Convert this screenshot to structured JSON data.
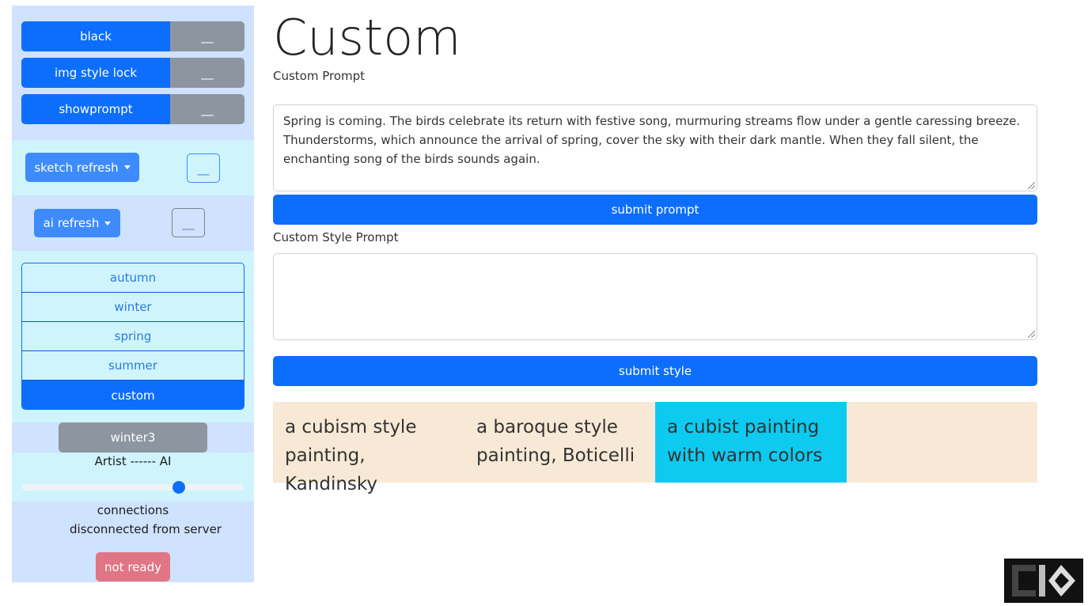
{
  "sidebar": {
    "toggles": [
      {
        "label": "black",
        "toggle_label": "__"
      },
      {
        "label": "img style lock",
        "toggle_label": "__"
      },
      {
        "label": "showprompt",
        "toggle_label": "__"
      }
    ],
    "sketch_refresh": {
      "label": "sketch refresh",
      "toggle_label": "__"
    },
    "ai_refresh": {
      "label": "ai refresh",
      "toggle_label": "__"
    },
    "seasons": [
      {
        "label": "autumn",
        "active": false
      },
      {
        "label": "winter",
        "active": false
      },
      {
        "label": "spring",
        "active": false
      },
      {
        "label": "summer",
        "active": false
      },
      {
        "label": "custom",
        "active": true
      }
    ],
    "preset_button": "winter3",
    "slider": {
      "label": "Artist ------ AI",
      "value_fraction": 0.72
    },
    "connections_label": "connections",
    "connection_status": "disconnected from server",
    "ready_button": "not ready"
  },
  "main": {
    "title": "Custom",
    "custom_prompt_label": "Custom Prompt",
    "custom_prompt_value": "Spring is coming. The birds celebrate its return with festive song, murmuring streams flow under a gentle caressing breeze. Thunderstorms, which announce the arrival of spring, cover the sky with their dark mantle. When they fall silent, the enchanting song of the birds sounds again.",
    "submit_prompt": "submit prompt",
    "custom_style_label": "Custom Style Prompt",
    "custom_style_value": "",
    "submit_style": "submit style",
    "style_cards": [
      {
        "text": "a cubism style painting, Kandinsky",
        "active": false
      },
      {
        "text": "a baroque style painting, Boticelli",
        "active": false
      },
      {
        "text": "a cubist painting with warm colors",
        "active": true
      },
      {
        "text": "",
        "active": false
      }
    ]
  },
  "colors": {
    "primary": "#0d6efd",
    "secondary": "#8d96a0",
    "sidebar_blue": "#cfe2ff",
    "sidebar_cyan": "#cff4fc",
    "card_bg": "#f8e9d6",
    "card_active": "#0dcaf0",
    "danger_soft": "#e07685"
  }
}
